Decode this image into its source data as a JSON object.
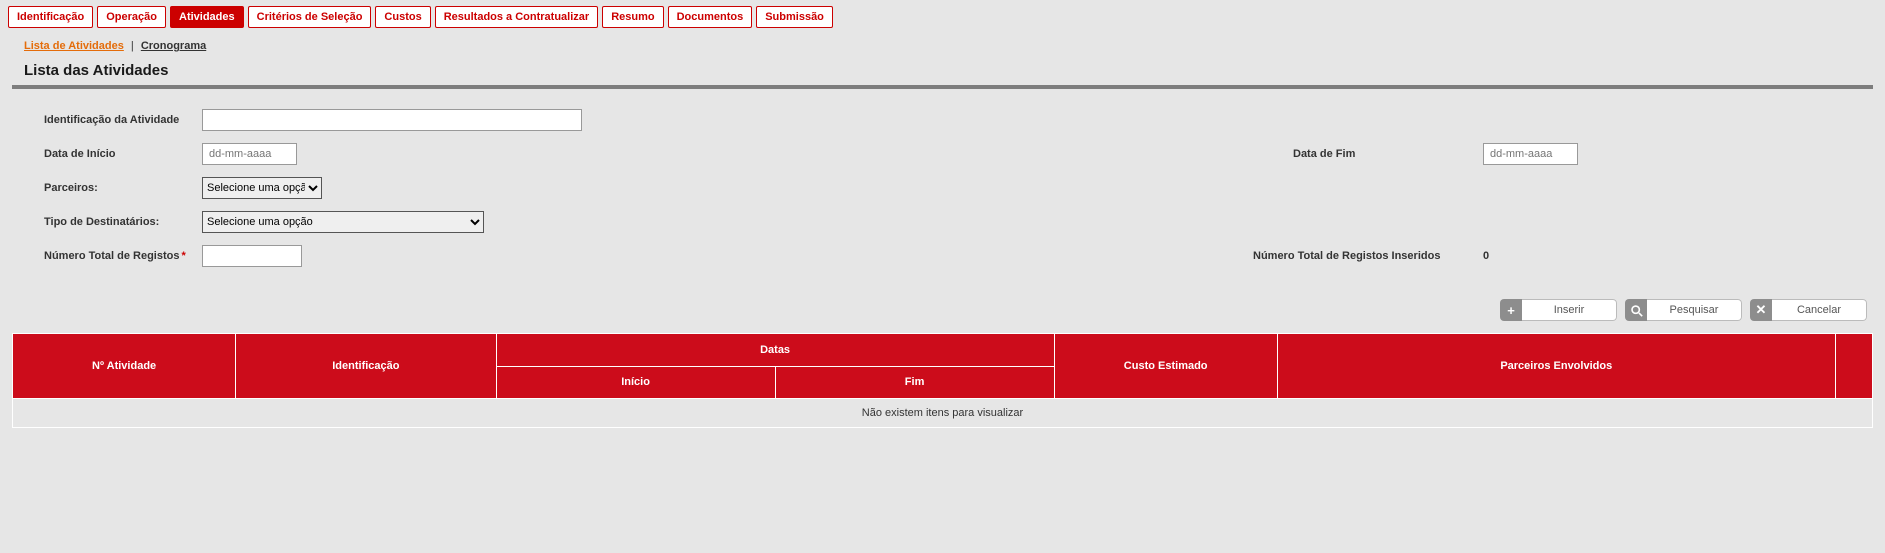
{
  "tabs": {
    "items": [
      {
        "label": "Identificação",
        "active": false
      },
      {
        "label": "Operação",
        "active": false
      },
      {
        "label": "Atividades",
        "active": true
      },
      {
        "label": "Critérios de Seleção",
        "active": false
      },
      {
        "label": "Custos",
        "active": false
      },
      {
        "label": "Resultados a Contratualizar",
        "active": false
      },
      {
        "label": "Resumo",
        "active": false
      },
      {
        "label": "Documentos",
        "active": false
      },
      {
        "label": "Submissão",
        "active": false
      }
    ]
  },
  "subnav": {
    "lista": "Lista de Atividades",
    "sep": "|",
    "cronograma": "Cronograma"
  },
  "section_title": "Lista das Atividades",
  "form": {
    "ident_label": "Identificação da Atividade",
    "ident_value": "",
    "data_inicio_label": "Data de Início",
    "data_inicio_placeholder": "dd-mm-aaaa",
    "data_fim_label": "Data de Fim",
    "data_fim_placeholder": "dd-mm-aaaa",
    "parceiros_label": "Parceiros:",
    "parceiros_option": "Selecione uma opção",
    "tipo_dest_label": "Tipo de Destinatários:",
    "tipo_dest_option": "Selecione uma opção",
    "num_total_label": "Número Total de Registos",
    "num_total_value": "",
    "num_inseridos_label": "Número Total de Registos Inseridos",
    "num_inseridos_value": "0"
  },
  "actions": {
    "inserir": "Inserir",
    "pesquisar": "Pesquisar",
    "cancelar": "Cancelar"
  },
  "table": {
    "headers": {
      "num": "Nº Atividade",
      "ident": "Identificação",
      "datas": "Datas",
      "inicio": "Início",
      "fim": "Fim",
      "custo": "Custo Estimado",
      "parceiros": "Parceiros Envolvidos"
    },
    "empty_text": "Não existem itens para visualizar"
  }
}
